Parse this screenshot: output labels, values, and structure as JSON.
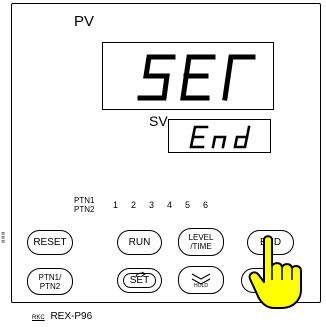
{
  "display": {
    "pv_label": "PV",
    "pv_value": "SEr",
    "sv_label": "SV",
    "sv_value": "End"
  },
  "pattern": {
    "label_line1": "PTN1",
    "label_line2": "PTN2",
    "numbers": [
      "1",
      "2",
      "3",
      "4",
      "5",
      "6"
    ]
  },
  "buttons": {
    "reset": "RESET",
    "run": "RUN",
    "level_time_line1": "LEVEL",
    "level_time_line2": "/TIME",
    "end": "END",
    "ptn_line1": "PTN1/",
    "ptn_line2": "PTN2",
    "set": "SET",
    "hold": "HOLD"
  },
  "icons": {
    "set_arrow": "refresh-arrow-icon",
    "hold": "double-chevron-down-icon",
    "hand": "pointing-hand-icon"
  },
  "footer": {
    "mark": "RKC",
    "model": "REX-P96"
  },
  "colors": {
    "hand_fill": "#ffff00",
    "stroke": "#000000"
  }
}
